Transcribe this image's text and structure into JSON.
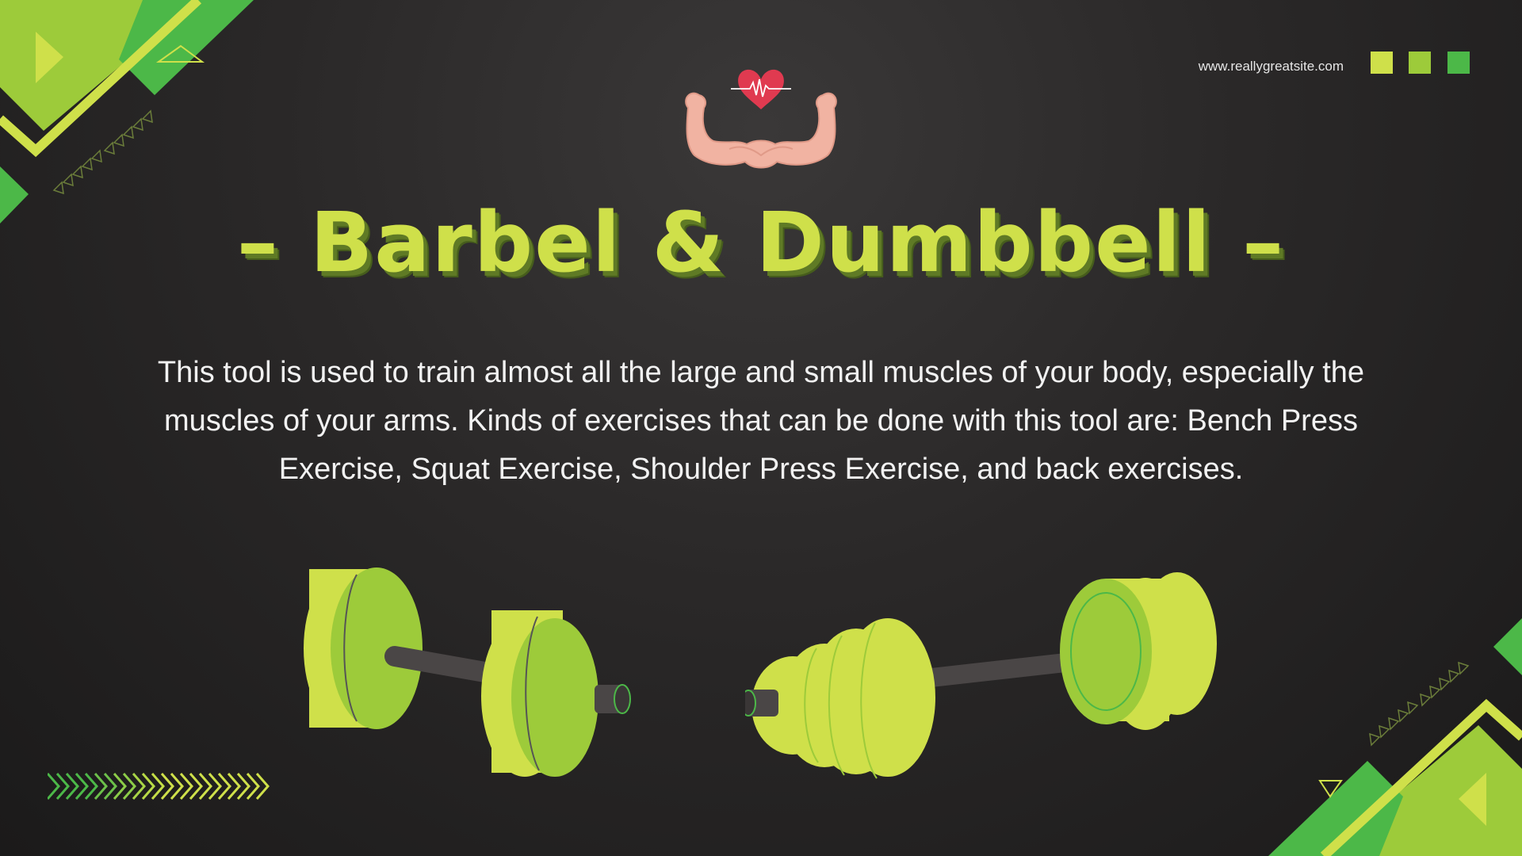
{
  "header": {
    "site_url": "www.reallygreatsite.com"
  },
  "title": "– Barbel & Dumbbell –",
  "description": "This tool is used to train almost all the large and small muscles of your body, especially the muscles of your arms. Kinds of exercises that can be done with this tool are: Bench Press Exercise, Squat Exercise, Shoulder Press Exercise, and back exercises.",
  "icons": {
    "logo": "flexed-arms-heart-icon",
    "barbell_left": "barbell-icon",
    "barbell_right": "dumbbell-icon",
    "chevrons": "chevron-arrows-icon"
  },
  "colors": {
    "accent_lime": "#cfe04a",
    "accent_light_green": "#9dcb3a",
    "accent_green": "#4cb848",
    "background": "#2a2828",
    "text": "#f2f2f2"
  }
}
